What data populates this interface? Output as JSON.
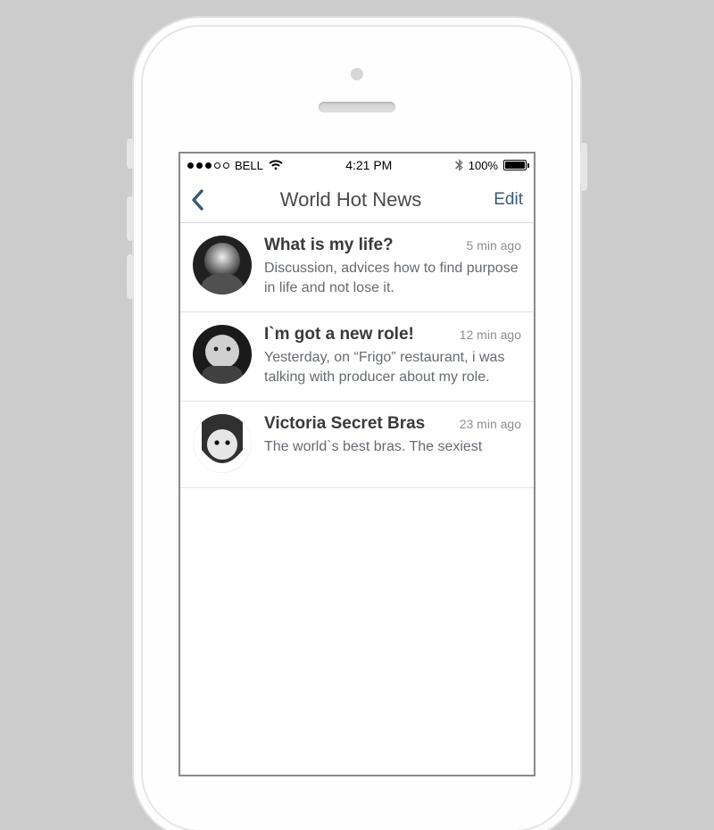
{
  "statusbar": {
    "carrier": "BELL",
    "signal_filled": 3,
    "signal_total": 5,
    "time": "4:21 PM",
    "battery_pct": "100%"
  },
  "navbar": {
    "title": "World Hot News",
    "edit_label": "Edit"
  },
  "list": {
    "items": [
      {
        "title": "What is my life?",
        "time": "5 min ago",
        "desc": "Discussion, advices how to find purpose in life and not lose it."
      },
      {
        "title": "I`m got a new role!",
        "time": "12 min ago",
        "desc": "Yesterday, on “Frigo” restaurant, i was talking with producer about my role."
      },
      {
        "title": "Victoria Secret Bras",
        "time": "23 min ago",
        "desc": "The world`s best bras. The sexiest"
      }
    ]
  }
}
